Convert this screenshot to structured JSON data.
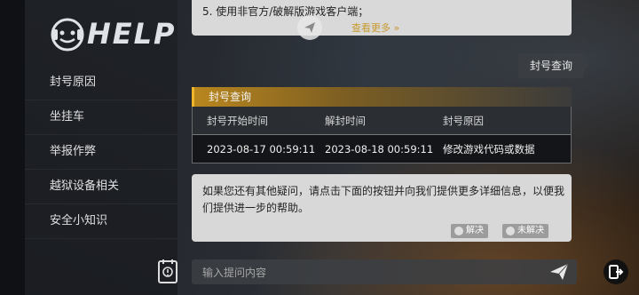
{
  "logo": {
    "text": "HELP"
  },
  "menu": [
    {
      "label": "封号原因"
    },
    {
      "label": "坐挂车"
    },
    {
      "label": "举报作弊"
    },
    {
      "label": "越狱设备相关"
    },
    {
      "label": "安全小知识"
    }
  ],
  "chat": {
    "top_bubble": {
      "line": "5. 使用非官方/破解版游戏客户端；",
      "see_more": "查看更多 »"
    },
    "user_message": "封号查询",
    "ban_card": {
      "title": "封号查询",
      "headers": [
        "封号开始时间",
        "解封时间",
        "封号原因"
      ],
      "row": [
        "2023-08-17 00:59:11",
        "2023-08-18 00:59:11",
        "修改游戏代码或数据"
      ]
    },
    "help_bubble": {
      "text": "如果您还有其他疑问，请点击下面的按钮并向我们提供更多详细信息，以便我们提供进一步的帮助。",
      "solved_label": "解决",
      "unsolved_label": "未解决"
    }
  },
  "input": {
    "placeholder": "输入提问内容"
  },
  "icons": {
    "logo": "headset-mascot-icon",
    "top_send": "send-icon",
    "help_book": "help-book-icon",
    "send": "send-icon",
    "exit": "exit-icon",
    "solved": "smile-icon",
    "unsolved": "frown-icon"
  },
  "colors": {
    "accent": "#f1b52a",
    "link": "#c89a2d"
  }
}
